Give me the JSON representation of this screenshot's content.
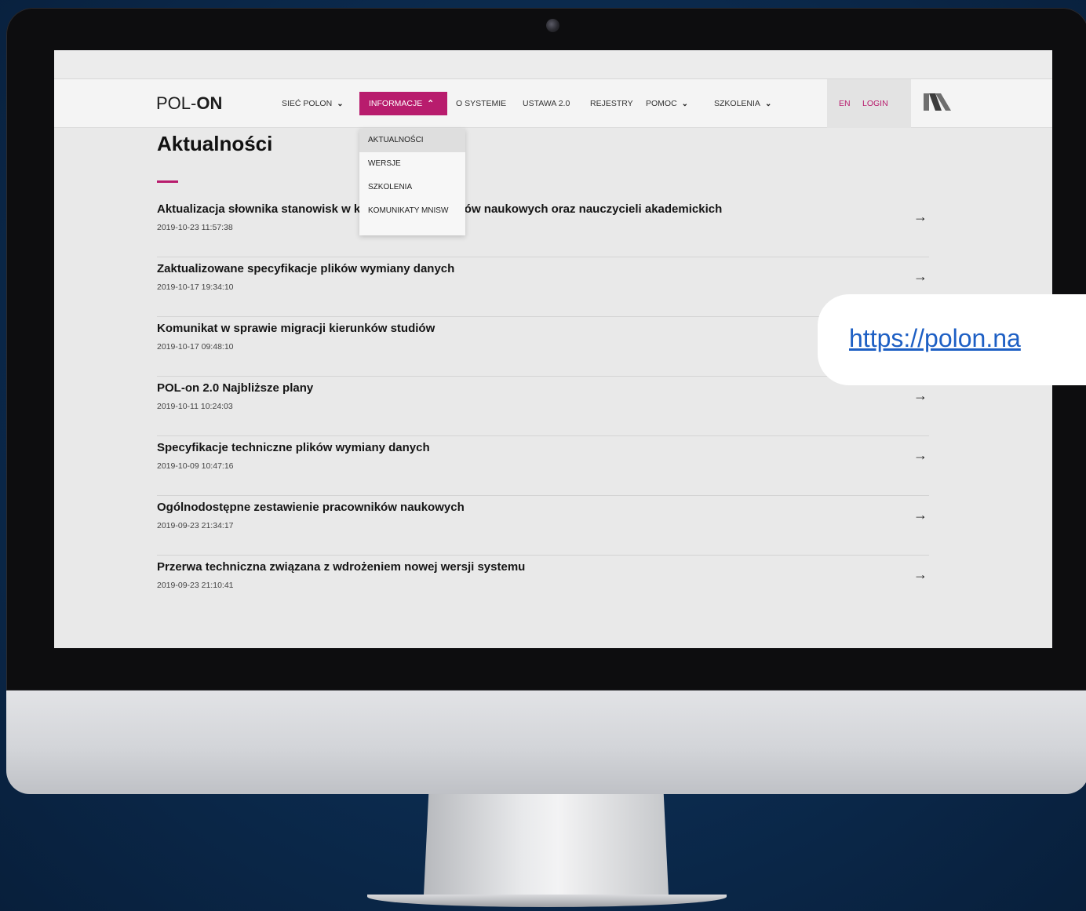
{
  "header": {
    "logo_left": "POL-",
    "logo_right": "ON",
    "nav": [
      {
        "label": "SIEĆ POLON",
        "has_chevron": true
      },
      {
        "label": "INFORMACJE",
        "has_chevron": true,
        "active": true
      },
      {
        "label": "O SYSTEMIE",
        "has_chevron": false
      },
      {
        "label": "USTAWA 2.0",
        "has_chevron": false
      },
      {
        "label": "REJESTRY",
        "has_chevron": false
      },
      {
        "label": "POMOC",
        "has_chevron": true
      },
      {
        "label": "SZKOLENIA",
        "has_chevron": true
      }
    ],
    "lang_label": "EN",
    "login_label": "LOGIN",
    "accent_color": "#b81c6d"
  },
  "dropdown": {
    "items": [
      {
        "label": "AKTUALNOŚCI",
        "active": true
      },
      {
        "label": "WERSJE"
      },
      {
        "label": "SZKOLENIA"
      },
      {
        "label": "KOMUNIKATY MNISW"
      }
    ]
  },
  "main": {
    "title": "Aktualności",
    "news": [
      {
        "title": "Aktualizacja słownika stanowisk w kategorii pracowników naukowych oraz nauczycieli akademickich",
        "date": "2019-10-23 11:57:38"
      },
      {
        "title": "Zaktualizowane specyfikacje plików wymiany danych",
        "date": "2019-10-17 19:34:10"
      },
      {
        "title": "Komunikat w sprawie migracji kierunków studiów",
        "date": "2019-10-17 09:48:10"
      },
      {
        "title": "POL-on 2.0 Najbliższe plany",
        "date": "2019-10-11 10:24:03"
      },
      {
        "title": "Specyfikacje techniczne plików wymiany danych",
        "date": "2019-10-09 10:47:16"
      },
      {
        "title": "Ogólnodostępne zestawienie pracowników naukowych",
        "date": "2019-09-23 21:34:17"
      },
      {
        "title": "Przerwa techniczna związana z wdrożeniem nowej wersji systemu",
        "date": "2019-09-23 21:10:41"
      }
    ],
    "arrow_icon": "arrow-right-icon"
  },
  "overlay": {
    "url_text": "https://polon.na"
  }
}
